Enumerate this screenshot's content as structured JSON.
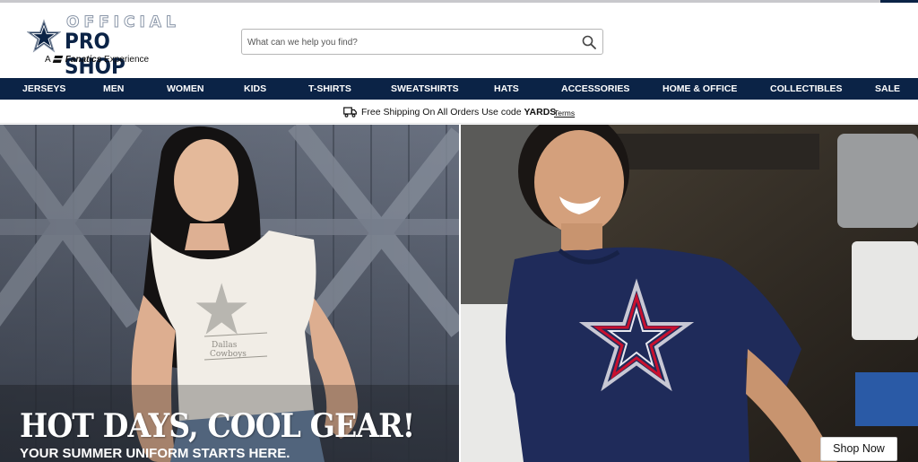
{
  "logo": {
    "line1": "OFFICIAL",
    "line2": "PRO SHOP",
    "prefix": "A",
    "brand": "Fanatics",
    "suffix": "Experience",
    "icon": "star-icon"
  },
  "search": {
    "placeholder": "What can we help you find?",
    "value": "",
    "icon": "search-icon"
  },
  "nav": {
    "items": [
      {
        "label": "JERSEYS"
      },
      {
        "label": "MEN"
      },
      {
        "label": "WOMEN"
      },
      {
        "label": "KIDS"
      },
      {
        "label": "T-SHIRTS"
      },
      {
        "label": "SWEATSHIRTS"
      },
      {
        "label": "HATS"
      },
      {
        "label": "ACCESSORIES"
      },
      {
        "label": "HOME & OFFICE"
      },
      {
        "label": "COLLECTIBLES"
      },
      {
        "label": "SALE"
      }
    ]
  },
  "promo": {
    "icon": "truck-icon",
    "text": "Free Shipping On All Orders Use code",
    "code": "YARDS",
    "terms": "Terms"
  },
  "hero": {
    "headline": "HOT DAYS, COOL GEAR!",
    "subline": "YOUR SUMMER UNIFORM STARTS HERE.",
    "cta": "Shop Now",
    "shirt_print_line1": "Dallas",
    "shirt_print_line2": "Cowboys"
  },
  "colors": {
    "navy": "#0b2346",
    "white": "#ffffff",
    "accent_red": "#c8102e"
  }
}
